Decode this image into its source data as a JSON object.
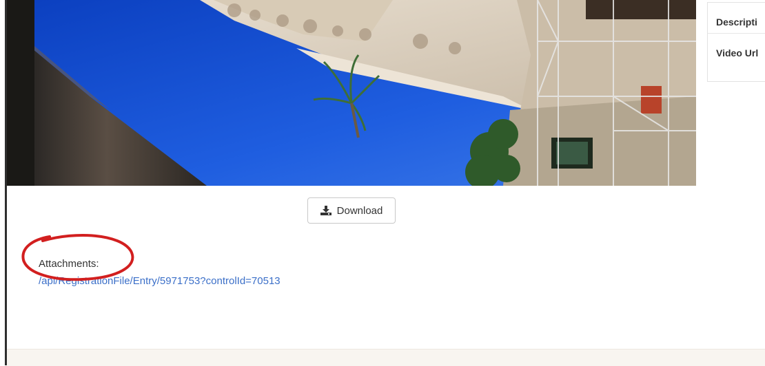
{
  "download_button": {
    "label": "Download",
    "icon": "download-icon"
  },
  "attachments": {
    "label": "Attachments:",
    "link_text": "/api/RegistrationFile/Entry/5971753?controlId=70513"
  },
  "side_panel": {
    "rows": [
      "Descripti",
      "Video Url"
    ]
  },
  "colors": {
    "link": "#3b6fc8",
    "annotation": "#d21f1f",
    "footer": "#f8f5f0"
  }
}
